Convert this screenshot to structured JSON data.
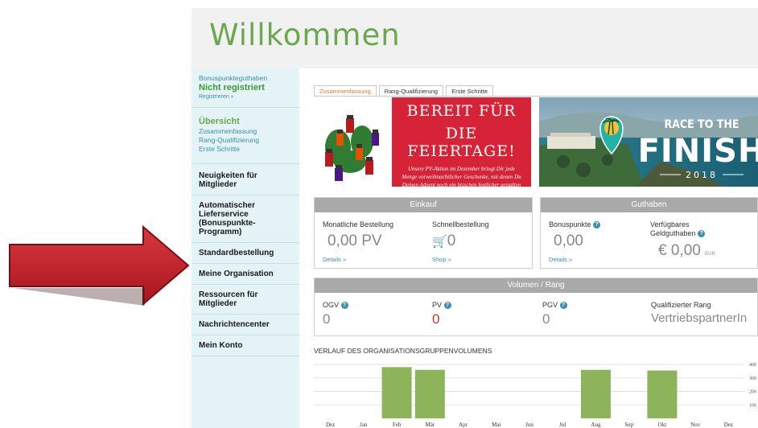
{
  "header": {
    "title": "Willkommen"
  },
  "sidebar": {
    "bonus_label": "Bonuspunkteguthaben",
    "bonus_status": "Nicht registriert",
    "register_link": "Registrieren »",
    "overview_title": "Übersicht",
    "overview_links": [
      "Zusammenfassung",
      "Rang-Qualifizierung",
      "Erste Schritte"
    ],
    "nav": [
      "Neuigkeiten für Mitglieder",
      "Automatischer Lieferservice (Bonuspunkte-Programm)",
      "Standardbestellung",
      "Meine Organisation",
      "Ressourcen für Mitglieder",
      "Nachrichtencenter",
      "Mein Konto"
    ]
  },
  "tabs": [
    "Zusammenfassung",
    "Rang-Qualifizierung",
    "Erste Schritte"
  ],
  "banner_feiertage": {
    "headline1": "BEREIT FÜR",
    "headline2": "DIE FEIERTAGE!",
    "text": "Unsere PV-Aktion im Dezember bringt Dir jede Menge vorweihnachtlicher Geschenke, mit denen Du Deinen Advent noch ein bisschen festlicher gestalten kannst."
  },
  "banner_race": {
    "line1": "RACE TO THE",
    "line2": "FINISH",
    "year": "2018"
  },
  "einkauf": {
    "title": "Einkauf",
    "monthly_label": "Monatliche Bestellung",
    "monthly_value": "0,00 PV",
    "monthly_link": "Details »",
    "quick_label": "Schnellbestellung",
    "quick_value": "0",
    "quick_link": "Shop »"
  },
  "guthaben": {
    "title": "Guthaben",
    "bonus_label": "Bonuspunkte",
    "bonus_value": "0,00",
    "bonus_link": "Details »",
    "credit_label": "Verfügbares Geldguthaben",
    "credit_value": "€ 0,00",
    "credit_unit": "EUR"
  },
  "volumen": {
    "title": "Volumen / Rang",
    "ogv_label": "OGV",
    "ogv_value": "0",
    "pv_label": "PV",
    "pv_value": "0",
    "pgv_label": "PGV",
    "pgv_value": "0",
    "rank_label": "Qualifizierter Rang",
    "rank_value": "VertriebspartnerIn"
  },
  "help_glyph": "?",
  "colors": {
    "accent_green": "#6aa84f",
    "bar_green": "#8db45a",
    "link_blue": "#3a8fb0",
    "pv_red": "#c0392b",
    "banner_red": "#d62337"
  },
  "chart_data": {
    "type": "bar",
    "title": "VERLAUF DES ORGANISATIONSGRUPPENVOLUMENS",
    "categories": [
      "Dez",
      "Jan",
      "Feb",
      "Mär",
      "Apr",
      "Mai",
      "Jun",
      "Jul",
      "Aug",
      "Sep",
      "Okt",
      "Nov",
      "Dez"
    ],
    "values": [
      0,
      0,
      380,
      360,
      0,
      0,
      0,
      0,
      360,
      0,
      355,
      0,
      0
    ],
    "yticks": [
      100,
      200,
      300,
      400
    ],
    "ylim": [
      0,
      400
    ],
    "grid": true
  }
}
